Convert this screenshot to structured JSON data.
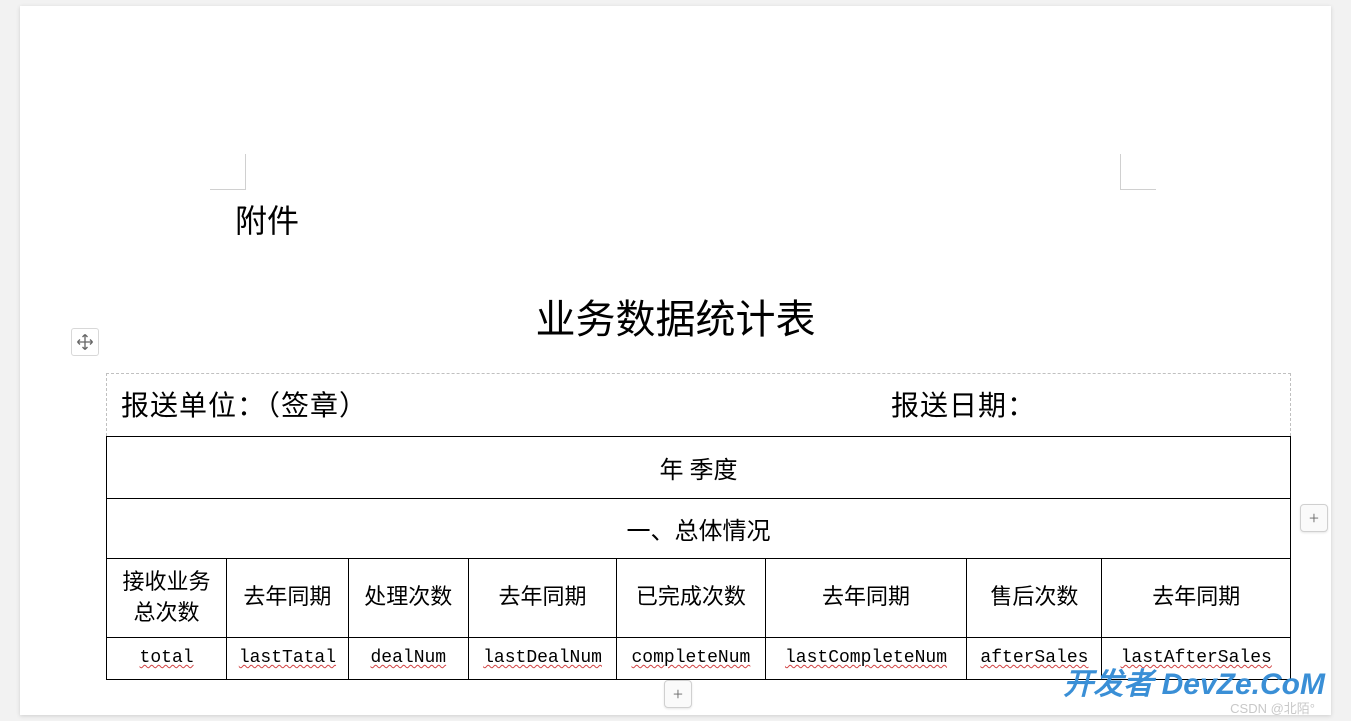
{
  "attachment_label": "附件",
  "doc_title": "业务数据统计表",
  "header": {
    "unit_label": "报送单位：（签章）",
    "date_label": "报送日期："
  },
  "table": {
    "period_row": "年 季度",
    "section_row": "一、总体情况",
    "columns": [
      {
        "header": "接收业务\n总次数",
        "value": "total"
      },
      {
        "header": "去年同期",
        "value": "lastTatal"
      },
      {
        "header": "处理次数",
        "value": "dealNum"
      },
      {
        "header": "去年同期",
        "value": "lastDealNum"
      },
      {
        "header": "已完成次数",
        "value": "completeNum"
      },
      {
        "header": "去年同期",
        "value": "lastCompleteNum"
      },
      {
        "header": "售后次数",
        "value": "afterSales"
      },
      {
        "header": "去年同期",
        "value": "lastAfterSales"
      }
    ]
  },
  "controls": {
    "plus": "+"
  },
  "watermark": {
    "csdn": "CSDN @北陌°",
    "brand": "开发者 DevZe.CoM"
  }
}
